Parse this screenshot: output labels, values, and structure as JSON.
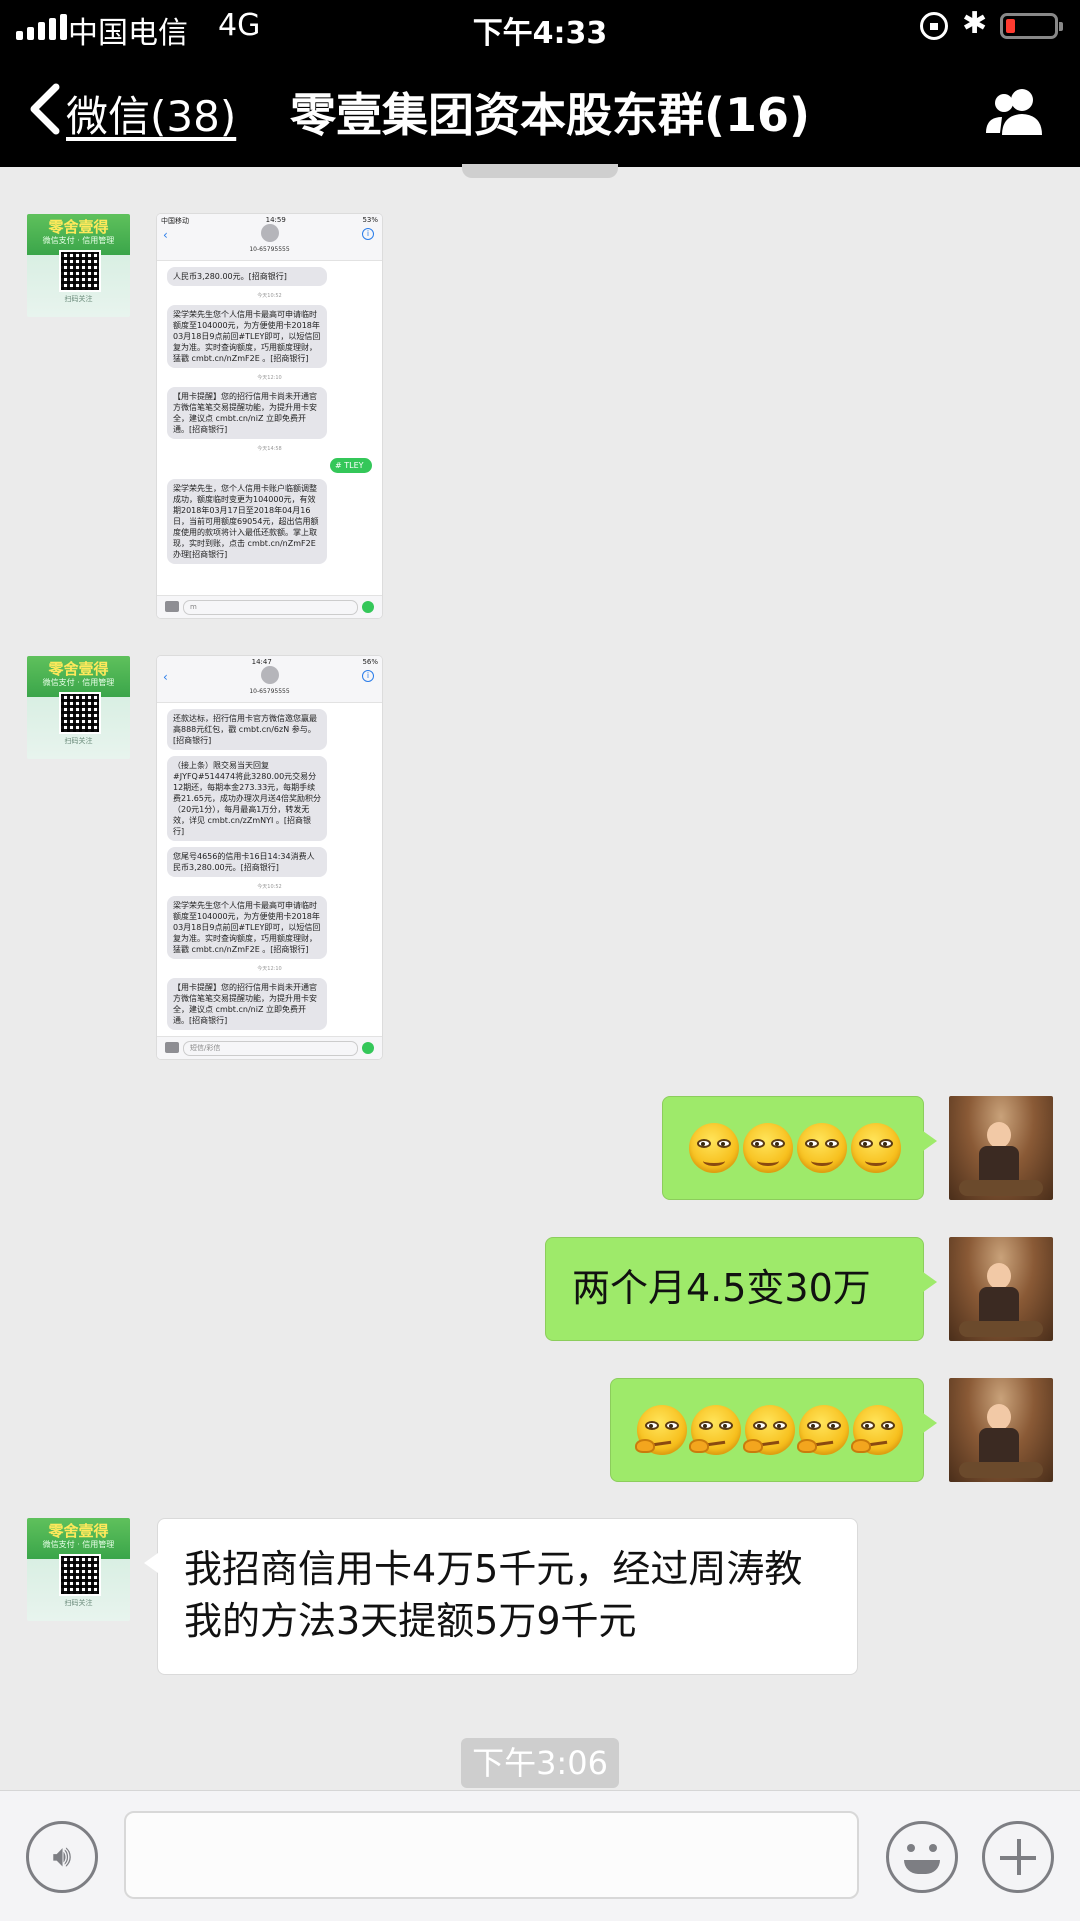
{
  "status_bar": {
    "carrier": "中国电信",
    "network": "4G",
    "time": "下午4:33"
  },
  "nav": {
    "back_label": "微信(38)",
    "title": "零壹集团资本股东群(16)",
    "back_icon": "chevron-left-icon",
    "people_icon": "group-people-icon"
  },
  "sender_avatar": {
    "title": "零舍壹得",
    "subtitle": "微信支付 · 信用管理",
    "footer": "扫码关注"
  },
  "screenshot_1": {
    "status_carrier": "中国移动",
    "status_time": "14:59",
    "status_battery": "53%",
    "number": "10-65795555",
    "messages": [
      {
        "type": "in",
        "text": "人民币3,280.00元。[招商银行]"
      },
      {
        "type": "time",
        "text": "今天10:52"
      },
      {
        "type": "in",
        "text": "梁学荣先生您个人信用卡最高可申请临时额度至104000元，为方便使用卡2018年03月18日9点前回#TLEY即可，以短信回复为准。实时查询额度，巧用额度理财，猛戳 cmbt.cn/nZmF2E 。[招商银行]"
      },
      {
        "type": "time",
        "text": "今天12:10"
      },
      {
        "type": "in",
        "text": "【用卡提醒】您的招行信用卡尚未开通官方微信笔笔交易提醒功能，为提升用卡安全，建议点 cmbt.cn/niZ 立即免费开通。[招商银行]"
      },
      {
        "type": "time",
        "text": "今天14:58"
      },
      {
        "type": "out",
        "text": "# TLEY"
      },
      {
        "type": "in",
        "text": "梁学荣先生，您个人信用卡账户临额调整成功，额度临时变更为104000元，有效期2018年03月17日至2018年04月16日，当前可用额度69054元，超出信用额度使用的款项将计入最低还款额。掌上取现，实时到账，点击 cmbt.cn/nZmF2E 办理[招商银行]"
      }
    ],
    "input_text": "m"
  },
  "screenshot_2": {
    "status_carrier": "",
    "status_time": "14:47",
    "status_battery": "56%",
    "number": "10-65795555",
    "messages": [
      {
        "type": "in",
        "text": "还款达标，招行信用卡官方微信邀您赢最高888元红包，戳 cmbt.cn/6zN 参与。[招商银行]"
      },
      {
        "type": "in",
        "text": "（接上条）限交易当天回复#JYFQ#514474将此3280.00元交易分12期还，每期本金273.33元，每期手续费21.65元，成功办理次月送4倍奖励积分（20元1分），每月最高1万分，转发无效，详见 cmbt.cn/zZmNYI 。[招商银行]"
      },
      {
        "type": "in",
        "text": "您尾号4656的信用卡16日14:34消费人民币3,280.00元。[招商银行]"
      },
      {
        "type": "time",
        "text": "今天10:52"
      },
      {
        "type": "in",
        "text": "梁学荣先生您个人信用卡最高可申请临时额度至104000元，为方便使用卡2018年03月18日9点前回#TLEY即可，以短信回复为准。实时查询额度，巧用额度理财，猛戳 cmbt.cn/nZmF2E 。[招商银行]"
      },
      {
        "type": "time",
        "text": "今天12:10"
      },
      {
        "type": "in",
        "text": "【用卡提醒】您的招行信用卡尚未开通官方微信笔笔交易提醒功能，为提升用卡安全，建议点 cmbt.cn/niZ 立即免费开通。[招商银行]"
      }
    ],
    "input_placeholder": "短信/彩信"
  },
  "messages": {
    "out_emoji_smirk": {
      "icon": "smirk-face-emoji",
      "count": 4
    },
    "out_text": "两个月4.5变30万",
    "out_emoji_think": {
      "icon": "thinking-face-emoji",
      "count": 5
    },
    "in_text": "我招商信用卡4万5千元，经过周涛教我的方法3天提额5万9千元"
  },
  "time_divider": "下午3:06",
  "input_bar": {
    "voice_icon": "voice-icon",
    "emoji_icon": "emoji-icon",
    "plus_icon": "plus-icon",
    "value": ""
  },
  "colors": {
    "bubble_out": "#9eea6a",
    "bubble_in": "#ffffff",
    "chat_bg": "#ebebeb",
    "header_bg": "#000000"
  }
}
